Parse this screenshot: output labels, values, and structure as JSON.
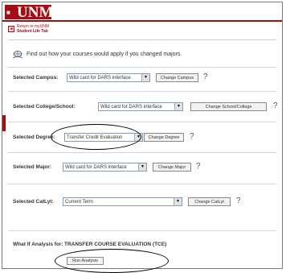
{
  "header": {
    "logo_text": "UNM"
  },
  "nav": {
    "return_link": "Return to myUNM",
    "tab_name": "Student Life Tab"
  },
  "info": {
    "text": "Find out how your courses would apply if you changed majors."
  },
  "rows": {
    "campus": {
      "label": "Selected Campus:",
      "value": "Wild card for DARS interface",
      "button": "Change Campus",
      "help": "?"
    },
    "college": {
      "label": "Selected College/School:",
      "value": "Wild card for DARS interface",
      "button": "Change School/College",
      "help": "?"
    },
    "degree": {
      "label": "Selected Degree:",
      "value": "Transfer Credit Evaluation",
      "button": "Change Degree",
      "help": "?"
    },
    "major": {
      "label": "Selected Major:",
      "value": "Wild card for DARS interface",
      "button": "Change Major",
      "help": "?"
    },
    "catlyt": {
      "label": "Selected CatLyt:",
      "value": "Current Term",
      "button": "Change CatLyt",
      "help": "?"
    }
  },
  "whatif": {
    "label": "What If Analysis for:",
    "value": "TRANSFER COURSE EVALUATION (TCE)",
    "button": "Run Analysis"
  },
  "colors": {
    "brand": "#a50d12"
  }
}
